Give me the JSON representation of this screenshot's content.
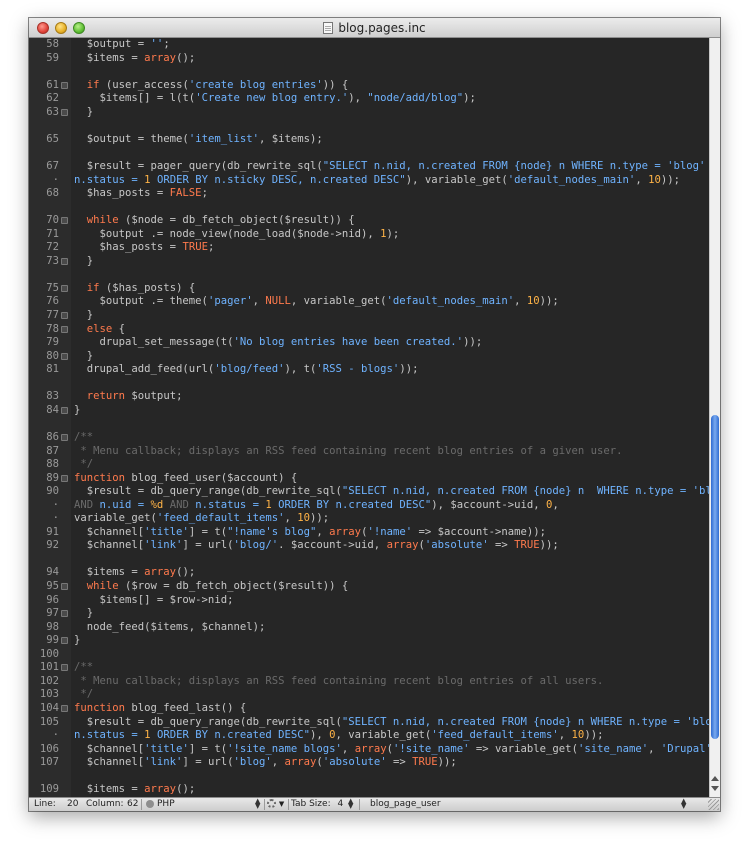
{
  "window": {
    "title": "blog.pages.inc"
  },
  "code_lines": [
    {
      "ln": "58",
      "fold": false,
      "tokens": [
        [
          "d",
          "  $output = "
        ],
        [
          "s",
          "''"
        ],
        [
          "d",
          ";"
        ]
      ]
    },
    {
      "ln": "59",
      "fold": false,
      "tokens": [
        [
          "d",
          "  $items = "
        ],
        [
          "k",
          "array"
        ],
        [
          "d",
          "();"
        ]
      ]
    },
    {
      "ln": "",
      "fold": false,
      "tokens": []
    },
    {
      "ln": "61",
      "fold": true,
      "tokens": [
        [
          "d",
          "  "
        ],
        [
          "k",
          "if"
        ],
        [
          "d",
          " (user_access("
        ],
        [
          "s",
          "'create blog entries'"
        ],
        [
          "d",
          ")) {"
        ]
      ]
    },
    {
      "ln": "62",
      "fold": false,
      "tokens": [
        [
          "d",
          "    $items[] = l(t("
        ],
        [
          "s",
          "'Create new blog entry.'"
        ],
        [
          "d",
          "), "
        ],
        [
          "s",
          "\"node/add/blog\""
        ],
        [
          "d",
          ");"
        ]
      ]
    },
    {
      "ln": "63",
      "fold": true,
      "tokens": [
        [
          "d",
          "  }"
        ]
      ]
    },
    {
      "ln": "",
      "fold": false,
      "tokens": []
    },
    {
      "ln": "65",
      "fold": false,
      "tokens": [
        [
          "d",
          "  $output = theme("
        ],
        [
          "s",
          "'item_list'"
        ],
        [
          "d",
          ", $items);"
        ]
      ]
    },
    {
      "ln": "",
      "fold": false,
      "tokens": []
    },
    {
      "ln": "67",
      "fold": false,
      "tokens": [
        [
          "d",
          "  $result = pager_query(db_rewrite_sql("
        ],
        [
          "s",
          "\"SELECT n.nid, n.created FROM {node} n WHERE n.type = 'blog' "
        ],
        [
          "c",
          "AND"
        ]
      ]
    },
    {
      "ln": "·",
      "fold": false,
      "tokens": [
        [
          "s",
          "n.status = "
        ],
        [
          "n",
          "1"
        ],
        [
          "s",
          " ORDER BY n.sticky DESC, n.created DESC\""
        ],
        [
          "d",
          "), variable_get("
        ],
        [
          "s",
          "'default_nodes_main'"
        ],
        [
          "d",
          ", "
        ],
        [
          "n",
          "10"
        ],
        [
          "d",
          "));"
        ]
      ],
      "wrap": true
    },
    {
      "ln": "68",
      "fold": false,
      "tokens": [
        [
          "d",
          "  $has_posts = "
        ],
        [
          "k",
          "FALSE"
        ],
        [
          "d",
          ";"
        ]
      ]
    },
    {
      "ln": "",
      "fold": false,
      "tokens": []
    },
    {
      "ln": "70",
      "fold": true,
      "tokens": [
        [
          "d",
          "  "
        ],
        [
          "k",
          "while"
        ],
        [
          "d",
          " ($node = db_fetch_object($result)) {"
        ]
      ]
    },
    {
      "ln": "71",
      "fold": false,
      "tokens": [
        [
          "d",
          "    $output .= node_view(node_load($node->nid), "
        ],
        [
          "n",
          "1"
        ],
        [
          "d",
          ");"
        ]
      ]
    },
    {
      "ln": "72",
      "fold": false,
      "tokens": [
        [
          "d",
          "    $has_posts = "
        ],
        [
          "k",
          "TRUE"
        ],
        [
          "d",
          ";"
        ]
      ]
    },
    {
      "ln": "73",
      "fold": true,
      "tokens": [
        [
          "d",
          "  }"
        ]
      ]
    },
    {
      "ln": "",
      "fold": false,
      "tokens": []
    },
    {
      "ln": "75",
      "fold": true,
      "tokens": [
        [
          "d",
          "  "
        ],
        [
          "k",
          "if"
        ],
        [
          "d",
          " ($has_posts) {"
        ]
      ]
    },
    {
      "ln": "76",
      "fold": false,
      "tokens": [
        [
          "d",
          "    $output .= theme("
        ],
        [
          "s",
          "'pager'"
        ],
        [
          "d",
          ", "
        ],
        [
          "k",
          "NULL"
        ],
        [
          "d",
          ", variable_get("
        ],
        [
          "s",
          "'default_nodes_main'"
        ],
        [
          "d",
          ", "
        ],
        [
          "n",
          "10"
        ],
        [
          "d",
          "));"
        ]
      ]
    },
    {
      "ln": "77",
      "fold": true,
      "tokens": [
        [
          "d",
          "  }"
        ]
      ]
    },
    {
      "ln": "78",
      "fold": true,
      "tokens": [
        [
          "d",
          "  "
        ],
        [
          "k",
          "else"
        ],
        [
          "d",
          " {"
        ]
      ]
    },
    {
      "ln": "79",
      "fold": false,
      "tokens": [
        [
          "d",
          "    drupal_set_message(t("
        ],
        [
          "s",
          "'No blog entries have been created.'"
        ],
        [
          "d",
          "));"
        ]
      ]
    },
    {
      "ln": "80",
      "fold": true,
      "tokens": [
        [
          "d",
          "  }"
        ]
      ]
    },
    {
      "ln": "81",
      "fold": false,
      "tokens": [
        [
          "d",
          "  drupal_add_feed(url("
        ],
        [
          "s",
          "'blog/feed'"
        ],
        [
          "d",
          "), t("
        ],
        [
          "s",
          "'RSS - blogs'"
        ],
        [
          "d",
          "));"
        ]
      ]
    },
    {
      "ln": "",
      "fold": false,
      "tokens": []
    },
    {
      "ln": "83",
      "fold": false,
      "tokens": [
        [
          "d",
          "  "
        ],
        [
          "k",
          "return"
        ],
        [
          "d",
          " $output;"
        ]
      ]
    },
    {
      "ln": "84",
      "fold": true,
      "tokens": [
        [
          "d",
          "}"
        ]
      ]
    },
    {
      "ln": "",
      "fold": false,
      "tokens": []
    },
    {
      "ln": "86",
      "fold": true,
      "tokens": [
        [
          "c",
          "/**"
        ]
      ]
    },
    {
      "ln": "87",
      "fold": false,
      "tokens": [
        [
          "c",
          " * Menu callback; displays an RSS feed containing recent blog entries of a given user."
        ]
      ]
    },
    {
      "ln": "88",
      "fold": false,
      "tokens": [
        [
          "c",
          " */"
        ]
      ]
    },
    {
      "ln": "89",
      "fold": true,
      "tokens": [
        [
          "k",
          "function"
        ],
        [
          "d",
          " blog_feed_user($account) {"
        ]
      ]
    },
    {
      "ln": "90",
      "fold": false,
      "tokens": [
        [
          "d",
          "  $result = db_query_range(db_rewrite_sql("
        ],
        [
          "s",
          "\"SELECT n.nid, n.created FROM {node} n  WHERE n.type = 'blog'"
        ]
      ]
    },
    {
      "ln": "·",
      "fold": false,
      "tokens": [
        [
          "c",
          "AND"
        ],
        [
          "s",
          " n.uid = "
        ],
        [
          "n",
          "%d"
        ],
        [
          "s",
          " "
        ],
        [
          "c",
          "AND"
        ],
        [
          "s",
          " n.status = "
        ],
        [
          "n",
          "1"
        ],
        [
          "s",
          " ORDER BY n.created DESC\""
        ],
        [
          "d",
          "), $account->uid, "
        ],
        [
          "n",
          "0"
        ],
        [
          "d",
          ","
        ]
      ],
      "wrap": true
    },
    {
      "ln": "·",
      "fold": false,
      "tokens": [
        [
          "d",
          "variable_get("
        ],
        [
          "s",
          "'feed_default_items'"
        ],
        [
          "d",
          ", "
        ],
        [
          "n",
          "10"
        ],
        [
          "d",
          "));"
        ]
      ],
      "wrap": true
    },
    {
      "ln": "91",
      "fold": false,
      "tokens": [
        [
          "d",
          "  $channel["
        ],
        [
          "s",
          "'title'"
        ],
        [
          "d",
          "] = t("
        ],
        [
          "s",
          "\"!name's blog\""
        ],
        [
          "d",
          ", "
        ],
        [
          "k",
          "array"
        ],
        [
          "d",
          "("
        ],
        [
          "s",
          "'!name'"
        ],
        [
          "d",
          " => $account->name));"
        ]
      ]
    },
    {
      "ln": "92",
      "fold": false,
      "tokens": [
        [
          "d",
          "  $channel["
        ],
        [
          "s",
          "'link'"
        ],
        [
          "d",
          "] = url("
        ],
        [
          "s",
          "'blog/'"
        ],
        [
          "d",
          ". $account->uid, "
        ],
        [
          "k",
          "array"
        ],
        [
          "d",
          "("
        ],
        [
          "s",
          "'absolute'"
        ],
        [
          "d",
          " => "
        ],
        [
          "k",
          "TRUE"
        ],
        [
          "d",
          "));"
        ]
      ]
    },
    {
      "ln": "",
      "fold": false,
      "tokens": []
    },
    {
      "ln": "94",
      "fold": false,
      "tokens": [
        [
          "d",
          "  $items = "
        ],
        [
          "k",
          "array"
        ],
        [
          "d",
          "();"
        ]
      ]
    },
    {
      "ln": "95",
      "fold": true,
      "tokens": [
        [
          "d",
          "  "
        ],
        [
          "k",
          "while"
        ],
        [
          "d",
          " ($row = db_fetch_object($result)) {"
        ]
      ]
    },
    {
      "ln": "96",
      "fold": false,
      "tokens": [
        [
          "d",
          "    $items[] = $row->nid;"
        ]
      ]
    },
    {
      "ln": "97",
      "fold": true,
      "tokens": [
        [
          "d",
          "  }"
        ]
      ]
    },
    {
      "ln": "98",
      "fold": false,
      "tokens": [
        [
          "d",
          "  node_feed($items, $channel);"
        ]
      ]
    },
    {
      "ln": "99",
      "fold": true,
      "tokens": [
        [
          "d",
          "}"
        ]
      ]
    },
    {
      "ln": "100",
      "fold": false,
      "tokens": []
    },
    {
      "ln": "101",
      "fold": true,
      "tokens": [
        [
          "c",
          "/**"
        ]
      ]
    },
    {
      "ln": "102",
      "fold": false,
      "tokens": [
        [
          "c",
          " * Menu callback; displays an RSS feed containing recent blog entries of all users."
        ]
      ]
    },
    {
      "ln": "103",
      "fold": false,
      "tokens": [
        [
          "c",
          " */"
        ]
      ]
    },
    {
      "ln": "104",
      "fold": true,
      "tokens": [
        [
          "k",
          "function"
        ],
        [
          "d",
          " blog_feed_last() {"
        ]
      ]
    },
    {
      "ln": "105",
      "fold": false,
      "tokens": [
        [
          "d",
          "  $result = db_query_range(db_rewrite_sql("
        ],
        [
          "s",
          "\"SELECT n.nid, n.created FROM {node} n WHERE n.type = 'blog' "
        ],
        [
          "c",
          "AND"
        ]
      ]
    },
    {
      "ln": "·",
      "fold": false,
      "tokens": [
        [
          "s",
          "n.status = "
        ],
        [
          "n",
          "1"
        ],
        [
          "s",
          " ORDER BY n.created DESC\""
        ],
        [
          "d",
          "), "
        ],
        [
          "n",
          "0"
        ],
        [
          "d",
          ", variable_get("
        ],
        [
          "s",
          "'feed_default_items'"
        ],
        [
          "d",
          ", "
        ],
        [
          "n",
          "10"
        ],
        [
          "d",
          "));"
        ]
      ],
      "wrap": true
    },
    {
      "ln": "106",
      "fold": false,
      "tokens": [
        [
          "d",
          "  $channel["
        ],
        [
          "s",
          "'title'"
        ],
        [
          "d",
          "] = t("
        ],
        [
          "s",
          "'!site_name blogs'"
        ],
        [
          "d",
          ", "
        ],
        [
          "k",
          "array"
        ],
        [
          "d",
          "("
        ],
        [
          "s",
          "'!site_name'"
        ],
        [
          "d",
          " => variable_get("
        ],
        [
          "s",
          "'site_name'"
        ],
        [
          "d",
          ", "
        ],
        [
          "s",
          "'Drupal'"
        ],
        [
          "d",
          ")));"
        ]
      ]
    },
    {
      "ln": "107",
      "fold": false,
      "tokens": [
        [
          "d",
          "  $channel["
        ],
        [
          "s",
          "'link'"
        ],
        [
          "d",
          "] = url("
        ],
        [
          "s",
          "'blog'"
        ],
        [
          "d",
          ", "
        ],
        [
          "k",
          "array"
        ],
        [
          "d",
          "("
        ],
        [
          "s",
          "'absolute'"
        ],
        [
          "d",
          " => "
        ],
        [
          "k",
          "TRUE"
        ],
        [
          "d",
          "));"
        ]
      ]
    },
    {
      "ln": "",
      "fold": false,
      "tokens": []
    },
    {
      "ln": "109",
      "fold": false,
      "tokens": [
        [
          "d",
          "  $items = "
        ],
        [
          "k",
          "array"
        ],
        [
          "d",
          "();"
        ]
      ]
    }
  ],
  "statusbar": {
    "line_label": "Line:",
    "line_value": "20",
    "column_label": "Column:",
    "column_value": "62",
    "language": "PHP",
    "tab_size_label": "Tab Size:",
    "tab_size_value": "4",
    "symbol": "blog_page_user"
  },
  "colors": {
    "keyword": "#ff7a4d",
    "string": "#6fb3ff",
    "number": "#ffb347",
    "comment": "#6a6a6a",
    "default": "#e6e6e6",
    "background": "#262626"
  }
}
